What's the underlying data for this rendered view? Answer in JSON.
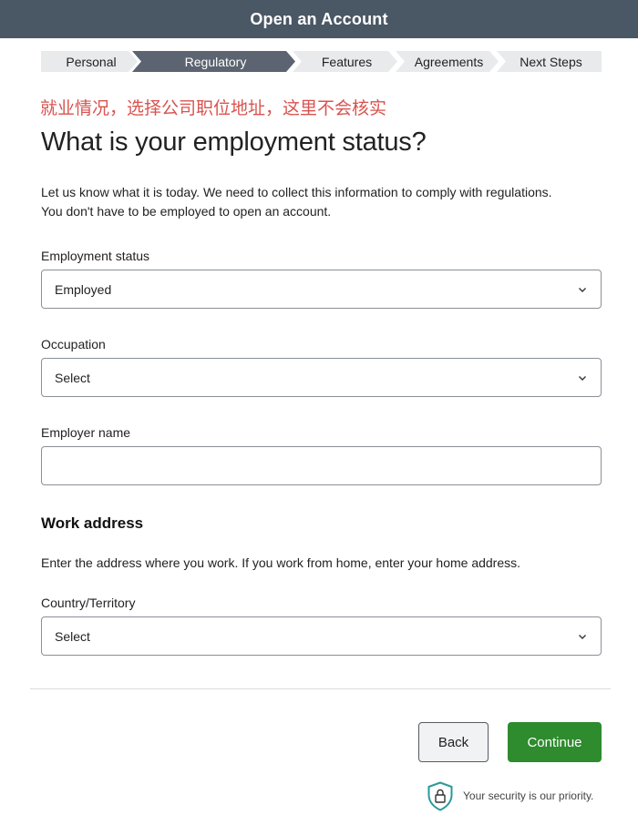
{
  "header": {
    "title": "Open an Account"
  },
  "steps": [
    {
      "label": "Personal",
      "active": false
    },
    {
      "label": "Regulatory",
      "active": true
    },
    {
      "label": "Features",
      "active": false
    },
    {
      "label": "Agreements",
      "active": false
    },
    {
      "label": "Next Steps",
      "active": false
    }
  ],
  "annotation": {
    "text": "就业情况，选择公司职位地址，这里不会核实",
    "color": "#d9534f"
  },
  "page": {
    "heading": "What is your employment status?",
    "intro_line1": "Let us know what it is today. We need to collect this information to comply with regulations.",
    "intro_line2": "You don't have to be employed to open an account."
  },
  "form": {
    "employment_status": {
      "label": "Employment status",
      "value": "Employed"
    },
    "occupation": {
      "label": "Occupation",
      "value": "Select"
    },
    "employer_name": {
      "label": "Employer name",
      "value": ""
    },
    "work_address": {
      "title": "Work address",
      "description": "Enter the address where you work. If you work from home, enter your home address.",
      "country": {
        "label": "Country/Territory",
        "value": "Select"
      }
    }
  },
  "buttons": {
    "back": "Back",
    "continue": "Continue"
  },
  "security": {
    "text": "Your security is our priority.",
    "icon": "shield-lock-icon"
  },
  "colors": {
    "header_bg": "#4a5765",
    "active_step": "#5b6470",
    "continue_bg": "#2e8b2e",
    "annotation": "#d9534f",
    "shield": "#2a9a9a"
  }
}
